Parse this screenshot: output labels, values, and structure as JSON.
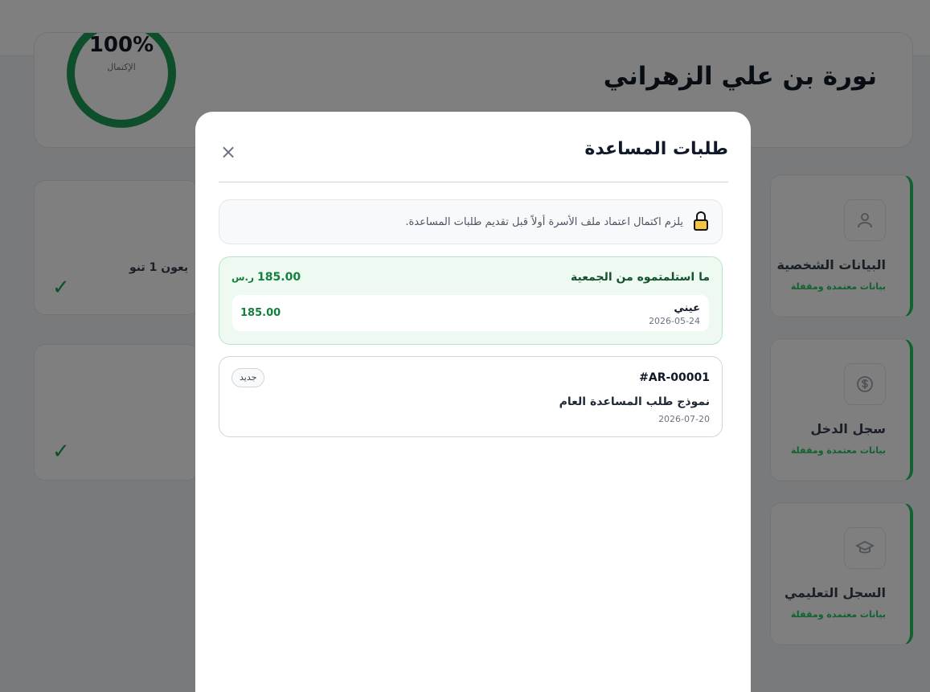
{
  "background": {
    "profile": {
      "name": "نورة بن علي الزهراني",
      "completion": "100%",
      "completion_label": "الإكتمال"
    },
    "side_cards": [
      {
        "title": "البيانات الشخصية",
        "status": "بيانات معتمدة ومقفلة",
        "icon": "user-icon"
      },
      {
        "title": "سجل الدخل",
        "status": "بيانات معتمدة ومقفلة",
        "icon": "dollar-icon"
      },
      {
        "title": "السجل التعليمي",
        "status": "بيانات معتمدة ومقفلة",
        "icon": "graduation-icon"
      }
    ],
    "mid_text": "يعون  1 تنو"
  },
  "modal": {
    "title": "طلبات المساعدة",
    "close_icon": "×",
    "notice": {
      "text": "يلزم اكتمال اعتماد ملف الأسرة أولاً قبل تقديم طلبات المساعدة.",
      "icon": "lock-icon"
    },
    "received": {
      "title": "ما استلمتموه من الجمعية",
      "total": "185.00",
      "currency": "ر.س",
      "items": [
        {
          "name": "عيني",
          "date": "2026-05-24",
          "amount": "185.00"
        }
      ]
    },
    "requests": [
      {
        "id": "#AR-00001",
        "badge": "جديد",
        "title": "نموذج طلب المساعدة العام",
        "date": "2026-07-20"
      }
    ]
  },
  "colors": {
    "accent_green": "#15803d",
    "received_bg": "#eefaf1",
    "overlay": "rgba(0,0,0,0.5)"
  }
}
